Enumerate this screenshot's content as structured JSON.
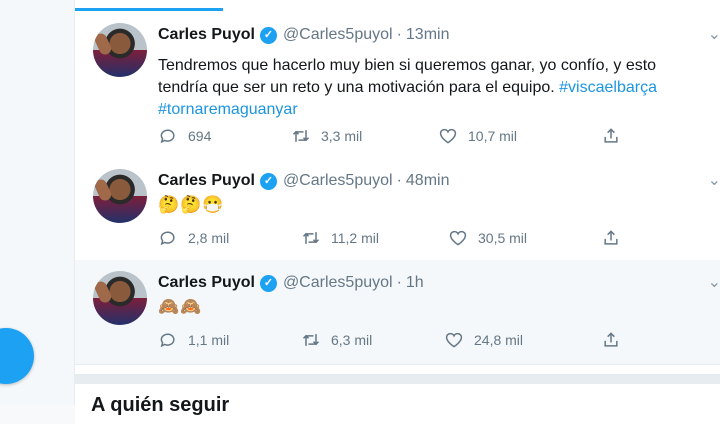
{
  "tweets": [
    {
      "name": "Carles Puyol",
      "handle": "@Carles5puyol",
      "separator": "·",
      "time": "13min",
      "text_plain": "Tendremos que hacerlo muy bien si queremos ganar, yo confío, y esto tendría que ser un reto y una motivación para el equipo. ",
      "hashtag1": "#viscaelbarça",
      "hashtag2": "#tornaremaguanyar",
      "replies": "694",
      "retweets": "3,3 mil",
      "likes": "10,7 mil"
    },
    {
      "name": "Carles Puyol",
      "handle": "@Carles5puyol",
      "separator": "·",
      "time": "48min",
      "emojis": "🤔🤔😷",
      "replies": "2,8 mil",
      "retweets": "11,2 mil",
      "likes": "30,5 mil"
    },
    {
      "name": "Carles Puyol",
      "handle": "@Carles5puyol",
      "separator": "·",
      "time": "1h",
      "emojis": "🙈🙈",
      "replies": "1,1 mil",
      "retweets": "6,3 mil",
      "likes": "24,8 mil"
    }
  ],
  "who_to_follow": {
    "title": "A quién seguir"
  },
  "icons": {
    "verified": "verified-badge-icon",
    "reply": "reply-icon",
    "retweet": "retweet-icon",
    "like": "like-icon",
    "share": "share-icon",
    "caret": "chevron-down-icon"
  },
  "colors": {
    "accent": "#1da1f2",
    "hashtag": "#1b95e0",
    "meta": "#657786"
  }
}
